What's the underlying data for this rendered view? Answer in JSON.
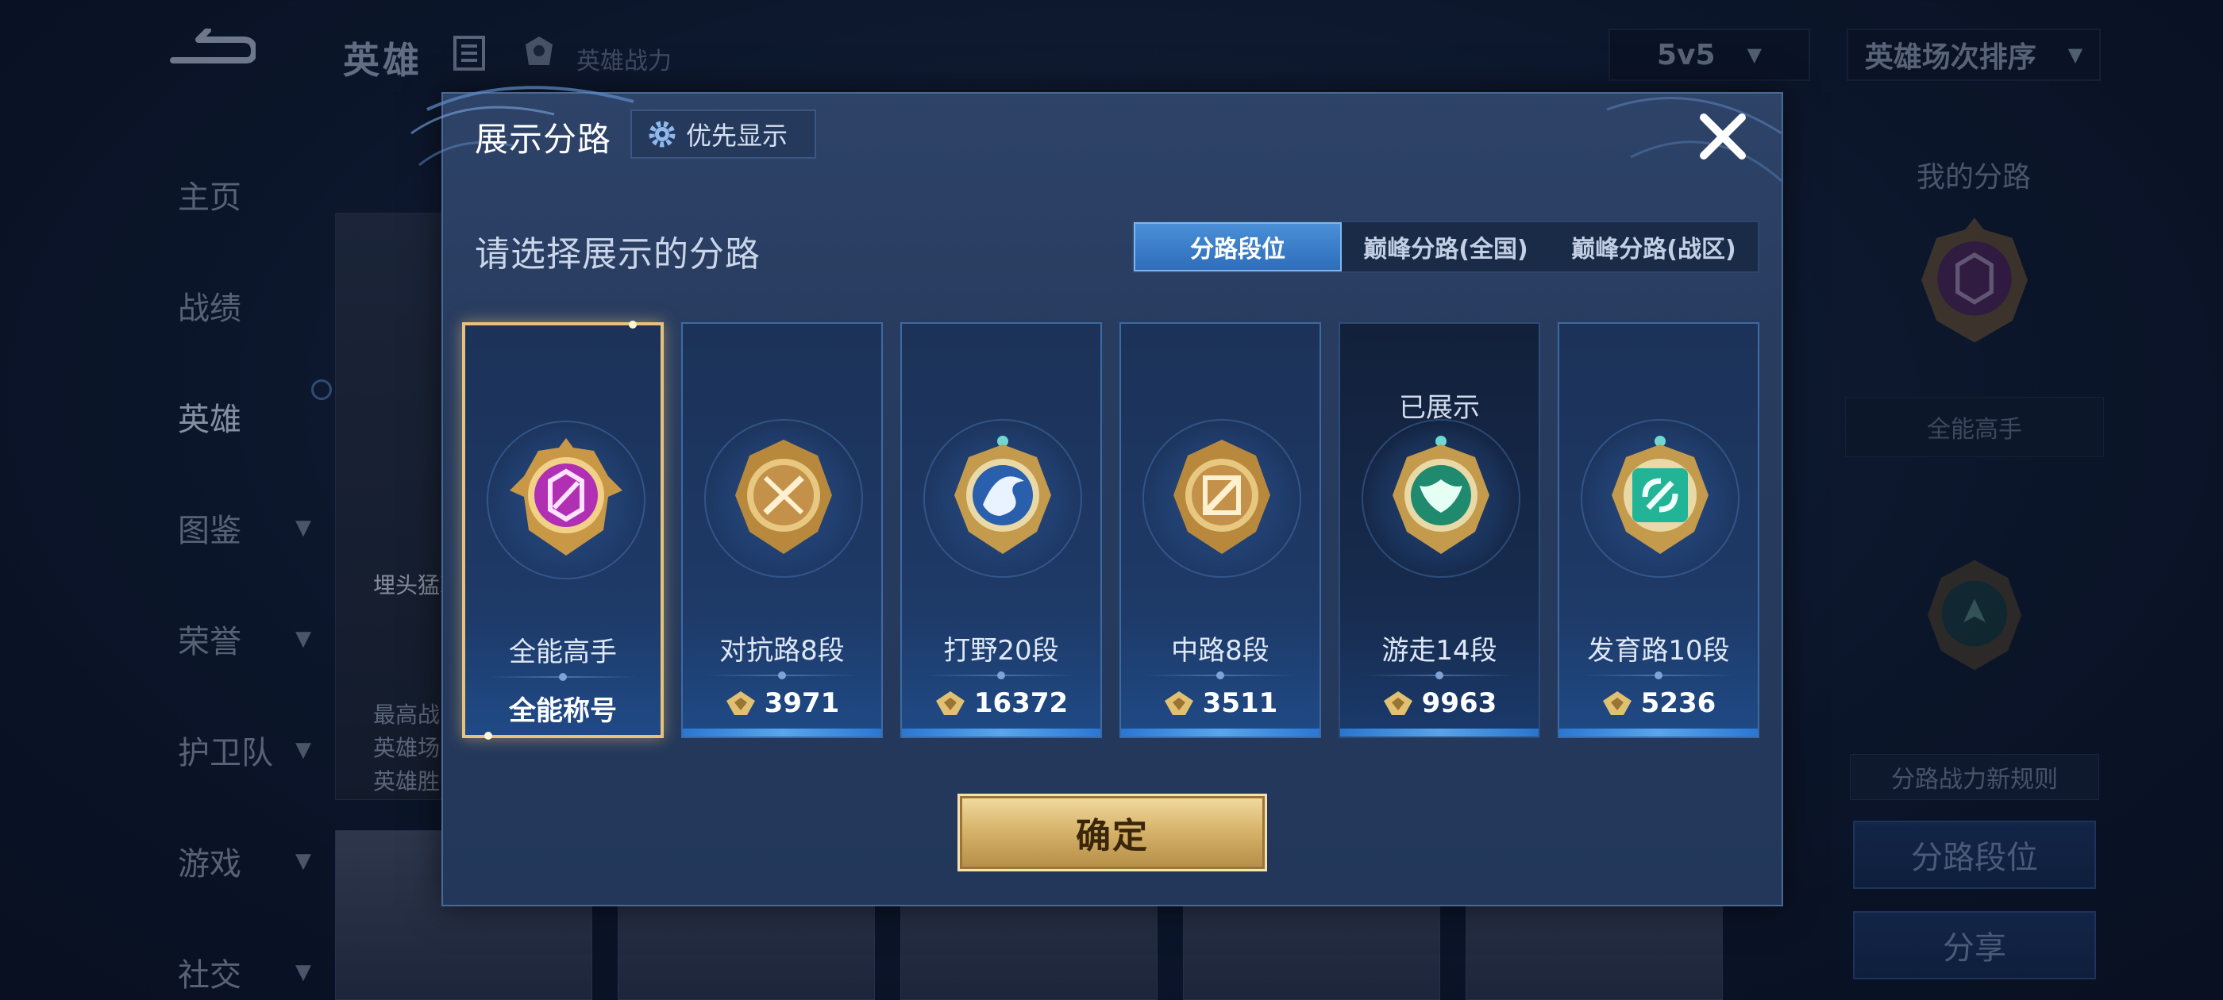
{
  "background": {
    "title": "英雄",
    "hero_power_label": "英雄战力",
    "mode_select": "5v5",
    "sort_select": "英雄场次排序",
    "nav": [
      {
        "label": "主页",
        "has_chevron": false
      },
      {
        "label": "战绩",
        "has_chevron": false
      },
      {
        "label": "英雄",
        "has_chevron": false,
        "active": true
      },
      {
        "label": "图鉴",
        "has_chevron": true
      },
      {
        "label": "荣誉",
        "has_chevron": true
      },
      {
        "label": "护卫队",
        "has_chevron": true
      },
      {
        "label": "游戏",
        "has_chevron": true
      },
      {
        "label": "社交",
        "has_chevron": true
      }
    ],
    "hero_card_text": "埋头猛冲",
    "hero_card_stats": [
      "最高战",
      "英雄场",
      "英雄胜"
    ],
    "right_panel": {
      "title": "我的分路",
      "role_label": "全能高手",
      "rule_link": "分路战力新规则",
      "lane_rank_button": "分路段位",
      "share_button": "分享"
    }
  },
  "dialog": {
    "title": "展示分路",
    "priority_button": "优先显示",
    "subtitle": "请选择展示的分路",
    "tabs": [
      "分路段位",
      "巅峰分路(全国)",
      "巅峰分路(战区)"
    ],
    "active_tab": 0,
    "cards": [
      {
        "rank": "全能高手",
        "bottom": "全能称号",
        "emblem": "all-round-emblem",
        "selected": true,
        "shown": false
      },
      {
        "rank": "对抗路8段",
        "score": "3971",
        "emblem": "clash-lane-emblem",
        "selected": false,
        "shown": false
      },
      {
        "rank": "打野20段",
        "score": "16372",
        "emblem": "jungle-emblem",
        "selected": false,
        "shown": false
      },
      {
        "rank": "中路8段",
        "score": "3511",
        "emblem": "mid-lane-emblem",
        "selected": false,
        "shown": false
      },
      {
        "rank": "游走14段",
        "score": "9963",
        "emblem": "roam-emblem",
        "selected": false,
        "shown": true,
        "shown_label": "已展示"
      },
      {
        "rank": "发育路10段",
        "score": "5236",
        "emblem": "farm-lane-emblem",
        "selected": false,
        "shown": false
      }
    ],
    "confirm_button": "确定"
  },
  "colors": {
    "accent_gold": "#d8b56c",
    "tab_active": "#2e6dba",
    "dialog_bg": "#2e4368"
  }
}
